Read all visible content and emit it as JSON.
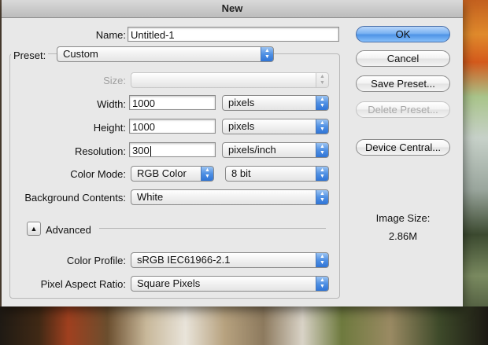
{
  "window": {
    "title": "New"
  },
  "name": {
    "label": "Name:",
    "value": "Untitled-1"
  },
  "preset": {
    "label": "Preset:",
    "value": "Custom"
  },
  "size": {
    "label": "Size:",
    "value": ""
  },
  "width": {
    "label": "Width:",
    "value": "1000",
    "unit": "pixels"
  },
  "height": {
    "label": "Height:",
    "value": "1000",
    "unit": "pixels"
  },
  "resolution": {
    "label": "Resolution:",
    "value": "300",
    "unit": "pixels/inch"
  },
  "color_mode": {
    "label": "Color Mode:",
    "value": "RGB Color",
    "depth": "8 bit"
  },
  "background": {
    "label": "Background Contents:",
    "value": "White"
  },
  "advanced": {
    "label": "Advanced"
  },
  "color_profile": {
    "label": "Color Profile:",
    "value": "sRGB IEC61966-2.1"
  },
  "pixel_aspect": {
    "label": "Pixel Aspect Ratio:",
    "value": "Square Pixels"
  },
  "buttons": {
    "ok": "OK",
    "cancel": "Cancel",
    "save_preset": "Save Preset...",
    "delete_preset": "Delete Preset...",
    "device_central": "Device Central..."
  },
  "image_size": {
    "label": "Image Size:",
    "value": "2.86M"
  }
}
